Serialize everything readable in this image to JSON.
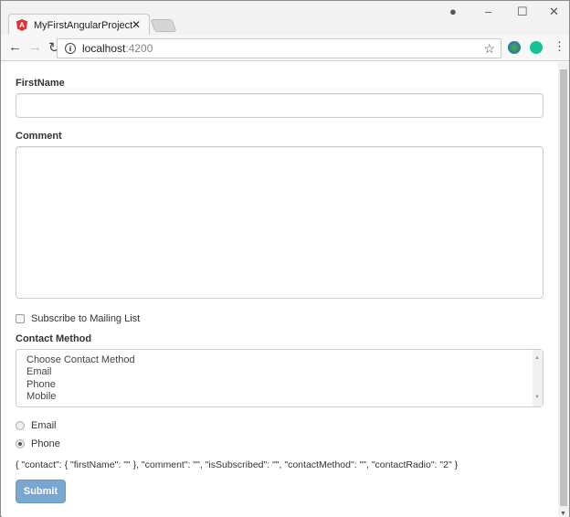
{
  "browser": {
    "tab_title": "MyFirstAngularProject",
    "url_host": "localhost",
    "url_port": ":4200",
    "tab_icon": "A"
  },
  "form": {
    "first_name_label": "FirstName",
    "first_name_value": "",
    "comment_label": "Comment",
    "comment_value": "",
    "subscribe_label": "Subscribe to Mailing List",
    "contact_method_label": "Contact Method",
    "contact_options": [
      "Choose Contact Method",
      "Email",
      "Phone",
      "Mobile"
    ],
    "radios": [
      {
        "label": "Email",
        "checked": false
      },
      {
        "label": "Phone",
        "checked": true
      }
    ],
    "json_output": "{ \"contact\": { \"firstName\": \"\" }, \"comment\": \"\", \"isSubscribed\": \"\", \"contactMethod\": \"\", \"contactRadio\": \"2\" }",
    "submit_label": "Submit"
  },
  "colors": {
    "submit": "#7aa7d2",
    "angular": "#dd3333"
  }
}
